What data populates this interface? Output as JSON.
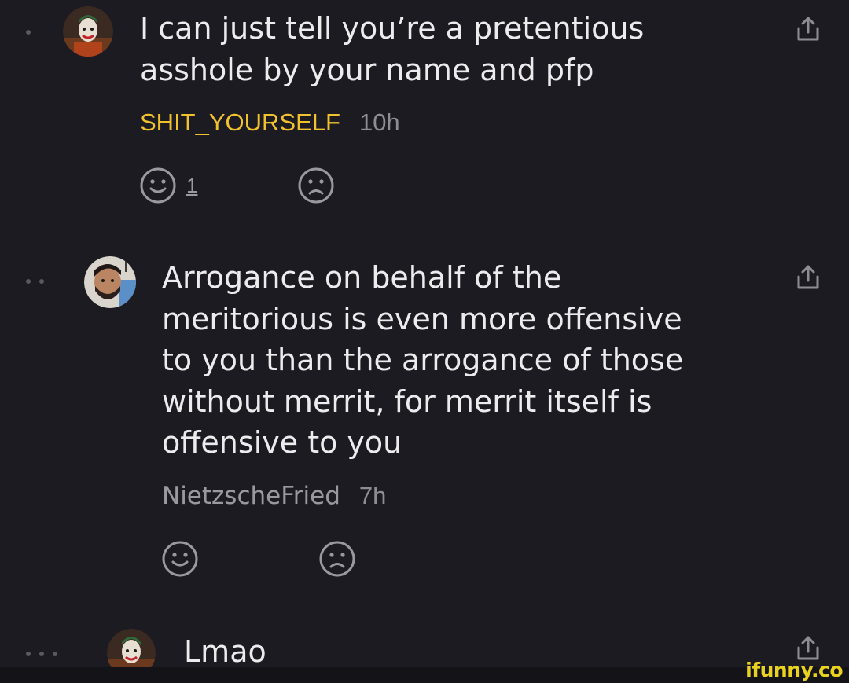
{
  "comments": [
    {
      "text": "I can just tell you’re a pretentious\nasshole by your name and pfp",
      "author": "SHIT_YOURSELF",
      "time": "10h",
      "smile_count": "1",
      "author_color": "#f2c12e"
    },
    {
      "text": "Arrogance on behalf of the\nmeritorious is even more offensive\nto you than the arrogance of those\nwithout merrit, for merrit itself is\noffensive to you",
      "author": "NietzscheFried",
      "time": "7h"
    },
    {
      "text": "Lmao"
    }
  ],
  "icons": {
    "smile": "smile-icon",
    "frown": "frown-icon",
    "share": "share-icon"
  },
  "watermark": "ifunny.co",
  "colors": {
    "background": "#1c1b21",
    "text": "#ececee",
    "muted": "#8e8d94",
    "accent_author": "#f2c12e",
    "watermark": "#e8d21f"
  }
}
